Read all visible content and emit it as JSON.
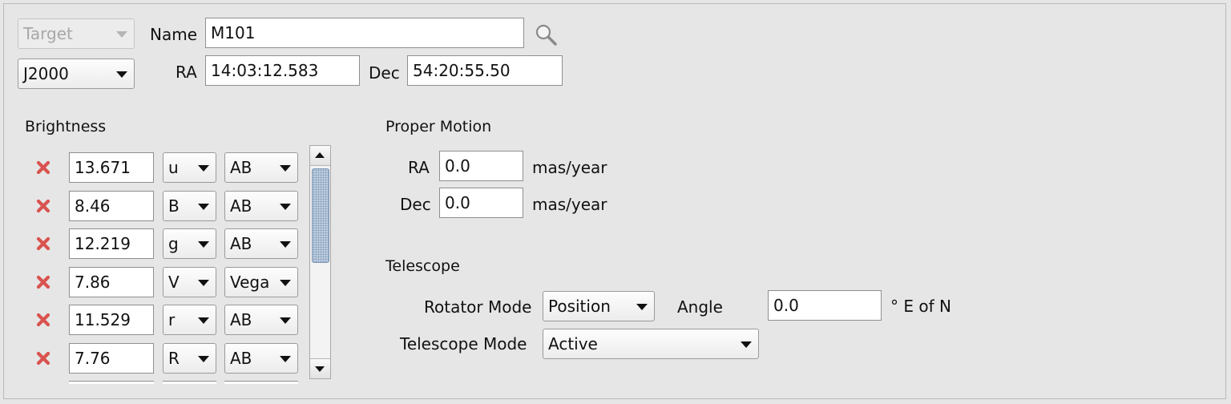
{
  "target": {
    "type_label": "Target",
    "name_label": "Name",
    "name_value": "M101",
    "coord_system": "J2000",
    "ra_label": "RA",
    "ra_value": "14:03:12.583",
    "dec_label": "Dec",
    "dec_value": "54:20:55.50"
  },
  "brightness": {
    "title": "Brightness",
    "rows": [
      {
        "value": "13.671",
        "band": "u",
        "system": "AB"
      },
      {
        "value": "8.46",
        "band": "B",
        "system": "AB"
      },
      {
        "value": "12.219",
        "band": "g",
        "system": "AB"
      },
      {
        "value": "7.86",
        "band": "V",
        "system": "Vega"
      },
      {
        "value": "11.529",
        "band": "r",
        "system": "AB"
      },
      {
        "value": "7.76",
        "band": "R",
        "system": "AB"
      }
    ]
  },
  "proper_motion": {
    "title": "Proper Motion",
    "ra_label": "RA",
    "ra_value": "0.0",
    "dec_label": "Dec",
    "dec_value": "0.0",
    "unit": "mas/year"
  },
  "telescope": {
    "title": "Telescope",
    "rotator_label": "Rotator Mode",
    "rotator_value": "Position",
    "angle_label": "Angle",
    "angle_value": "0.0",
    "angle_unit": "° E of N",
    "mode_label": "Telescope Mode",
    "mode_value": "Active"
  },
  "colors": {
    "background": "#e6e6e6",
    "delete_icon": "#d9534f"
  }
}
